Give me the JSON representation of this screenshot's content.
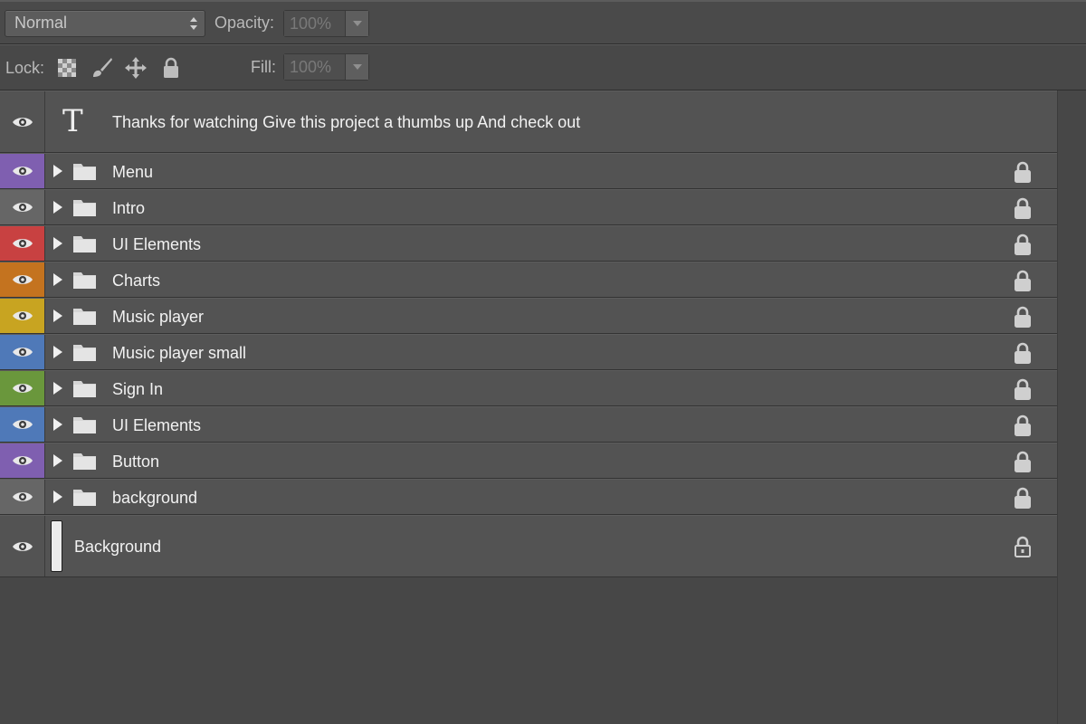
{
  "blend": {
    "mode": "Normal",
    "opacity_label": "Opacity:",
    "opacity_value": "100%"
  },
  "lock": {
    "label": "Lock:",
    "fill_label": "Fill:",
    "fill_value": "100%"
  },
  "layers": [
    {
      "name": "Thanks for watching Give this project a thumbs up And check out",
      "type": "text",
      "color": "#535353"
    },
    {
      "name": "Menu",
      "type": "group",
      "color": "#7f5fb0"
    },
    {
      "name": "Intro",
      "type": "group",
      "color": "#666666"
    },
    {
      "name": "UI Elements",
      "type": "group",
      "color": "#c84141"
    },
    {
      "name": "Charts",
      "type": "group",
      "color": "#c4731f"
    },
    {
      "name": "Music player",
      "type": "group",
      "color": "#c8a421"
    },
    {
      "name": "Music player small",
      "type": "group",
      "color": "#4f79b8"
    },
    {
      "name": "Sign In",
      "type": "group",
      "color": "#6a973c"
    },
    {
      "name": "UI Elements",
      "type": "group",
      "color": "#4f79b8"
    },
    {
      "name": "Button",
      "type": "group",
      "color": "#7f5fb0"
    },
    {
      "name": "background",
      "type": "group",
      "color": "#666666"
    },
    {
      "name": "Background",
      "type": "background",
      "color": "#535353"
    }
  ],
  "icons": {
    "visibility": "eye-icon",
    "group": "folder-icon",
    "lock": "lock-icon",
    "text_layer": "type-layer-icon",
    "lock_transparent": "lock-transparent-pixels-icon",
    "lock_image": "lock-image-pixels-icon",
    "lock_position": "lock-position-icon",
    "lock_all": "lock-all-icon"
  }
}
